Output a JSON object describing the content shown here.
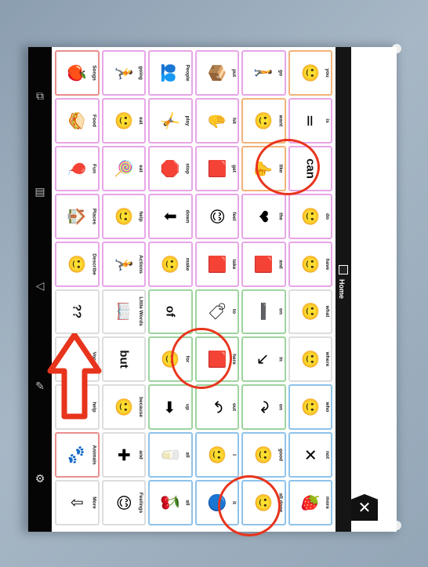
{
  "header": {
    "home_label": "Home",
    "close_glyph": "✕"
  },
  "nav_icons": [
    "copy-icon",
    "keyboard-icon",
    "back-icon",
    "pencil-icon",
    "gear-icon"
  ],
  "rows": [
    [
      {
        "label": "Songs",
        "sym": "🍎",
        "c": "#ea8e8e"
      },
      {
        "label": "going",
        "sym": "🏃",
        "c": "#e7a6e7"
      },
      {
        "label": "People",
        "sym": "👥",
        "c": "#e7a6e7"
      },
      {
        "label": "put",
        "sym": "📦",
        "c": "#e7a6e7"
      },
      {
        "label": "go",
        "sym": "🚶",
        "c": "#e7a6e7"
      },
      {
        "label": "you",
        "sym": "🙂",
        "c": "#f2b37a"
      }
    ],
    [
      {
        "label": "Food",
        "sym": "🥪",
        "c": "#e7a6e7"
      },
      {
        "label": "eat",
        "sym": "🙂",
        "c": "#e7a6e7"
      },
      {
        "label": "play",
        "sym": "🤸",
        "c": "#e7a6e7"
      },
      {
        "label": "hit",
        "sym": "✋",
        "c": "#e7a6e7"
      },
      {
        "label": "want",
        "sym": "🙂",
        "c": "#f2b37a"
      },
      {
        "label": "is",
        "sym": "=",
        "c": "#e7a6e7"
      }
    ],
    [
      {
        "label": "Fun",
        "sym": "🎈",
        "c": "#e7a6e7"
      },
      {
        "label": "eat",
        "sym": "🍭",
        "c": "#e7a6e7"
      },
      {
        "label": "stop",
        "sym": "🛑",
        "c": "#e7a6e7"
      },
      {
        "label": "get",
        "sym": "🟥",
        "c": "#e7a6e7"
      },
      {
        "label": "like",
        "sym": "👍",
        "c": "#f2b37a"
      },
      {
        "label": "can",
        "sym": "can",
        "c": "#e7a6e7",
        "word": true
      }
    ],
    [
      {
        "label": "Places",
        "sym": "🏠",
        "c": "#e7a6e7"
      },
      {
        "label": "help",
        "sym": "🙂",
        "c": "#e7a6e7"
      },
      {
        "label": "down",
        "sym": "⬇",
        "c": "#e7a6e7"
      },
      {
        "label": "feel",
        "sym": "😊",
        "c": "#e7a6e7"
      },
      {
        "label": "the",
        "sym": "❤",
        "c": "#e7a6e7"
      },
      {
        "label": "do",
        "sym": "🙂",
        "c": "#e7a6e7"
      }
    ],
    [
      {
        "label": "Describe",
        "sym": "🙂",
        "c": "#e7a6e7"
      },
      {
        "label": "Actions",
        "sym": "🏃",
        "c": "#e7a6e7"
      },
      {
        "label": "make",
        "sym": "🙂",
        "c": "#e7a6e7"
      },
      {
        "label": "take",
        "sym": "🟥",
        "c": "#e7a6e7"
      },
      {
        "label": "and",
        "sym": "🟥",
        "c": "#e7a6e7"
      },
      {
        "label": "have",
        "sym": "🙂",
        "c": "#e7a6e7"
      }
    ],
    [
      {
        "label": "Questions?",
        "sym": "??",
        "c": "#dddddd",
        "word": true
      },
      {
        "label": "Little Words",
        "sym": "📖",
        "c": "#dddddd"
      },
      {
        "label": "of",
        "sym": "of",
        "c": "#9ed49e",
        "word": true
      },
      {
        "label": "to",
        "sym": "🏷",
        "c": "#9ed49e"
      },
      {
        "label": "on",
        "sym": "➖",
        "c": "#9ed49e"
      },
      {
        "label": "what",
        "sym": "🙂",
        "c": "#dddddd"
      }
    ],
    [
      {
        "label": "Vocab",
        "sym": "⬆",
        "c": "#dddddd"
      },
      {
        "label": "but",
        "sym": "but",
        "c": "#dddddd",
        "word": true
      },
      {
        "label": "for",
        "sym": "🙂",
        "c": "#9ed49e"
      },
      {
        "label": "here",
        "sym": "🟥",
        "c": "#9ed49e"
      },
      {
        "label": "in",
        "sym": "↘",
        "c": "#9ed49e"
      },
      {
        "label": "where",
        "sym": "🙂",
        "c": "#dddddd"
      }
    ],
    [
      {
        "label": "help",
        "sym": "🙂",
        "c": "#dddddd"
      },
      {
        "label": "because",
        "sym": "🙂",
        "c": "#dddddd"
      },
      {
        "label": "up",
        "sym": "➡",
        "c": "#9ed49e"
      },
      {
        "label": "out",
        "sym": "↶",
        "c": "#9ed49e"
      },
      {
        "label": "on",
        "sym": "↷",
        "c": "#9ed49e"
      },
      {
        "label": "who",
        "sym": "🙂",
        "c": "#8fc3ea"
      }
    ],
    [
      {
        "label": "Animals",
        "sym": "🐾",
        "c": "#ea8e8e"
      },
      {
        "label": "and",
        "sym": "✚",
        "c": "#dddddd"
      },
      {
        "label": "all",
        "sym": "🥛",
        "c": "#8fc3ea"
      },
      {
        "label": "I",
        "sym": "🙂",
        "c": "#8fc3ea"
      },
      {
        "label": "good",
        "sym": "🙂",
        "c": "#8fc3ea"
      },
      {
        "label": "not",
        "sym": "✕",
        "c": "#8fc3ea"
      }
    ],
    [
      {
        "label": "More",
        "sym": "⇩",
        "c": "#dddddd"
      },
      {
        "label": "Feelings",
        "sym": "😊",
        "c": "#dddddd"
      },
      {
        "label": "all",
        "sym": "🍒",
        "c": "#8fc3ea"
      },
      {
        "label": "it",
        "sym": "🔵",
        "c": "#8fc3ea"
      },
      {
        "label": "all done",
        "sym": "🙂",
        "c": "#8fc3ea"
      },
      {
        "label": "more",
        "sym": "🍓",
        "c": "#8fc3ea"
      }
    ]
  ]
}
